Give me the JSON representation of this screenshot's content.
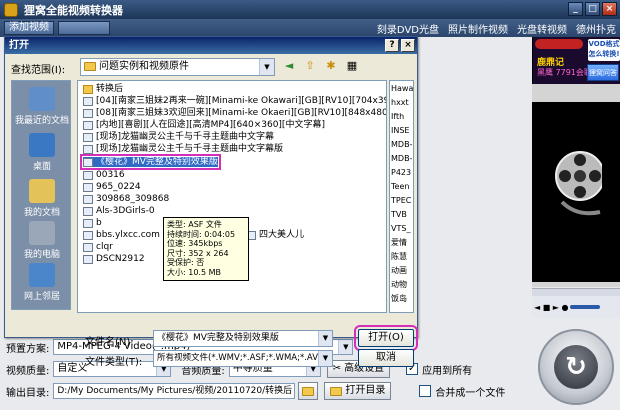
{
  "app": {
    "title": "狸窝全能视频转换器",
    "window_controls": [
      "_",
      "□",
      "×"
    ]
  },
  "toolbar": {
    "add_video": "添加视频",
    "dim_button": "",
    "right_items": [
      "刻录DVD光盘",
      "照片制作视频",
      "光盘转视频",
      "德州扑克"
    ]
  },
  "ad": {
    "vod_text": "VOD格式 怎么转换!",
    "headline": "鹿鼎记",
    "sub": "黑鹰 7791会联盟",
    "button": "狸窝问答"
  },
  "preview": {
    "controls": "◄ ■ ► ●"
  },
  "dialog": {
    "title": "打开",
    "close": "×",
    "help": "?",
    "lookin_label": "查找范围(I):",
    "lookin_value": "问题实例和视频原件",
    "places": [
      {
        "label": "我最近的文档",
        "color": "#5f8ec9"
      },
      {
        "label": "桌面",
        "color": "#3a78c4"
      },
      {
        "label": "我的文档",
        "color": "#e3c25a"
      },
      {
        "label": "我的电脑",
        "color": "#9aa7b8"
      },
      {
        "label": "网上邻居",
        "color": "#4a86c9"
      }
    ],
    "files": [
      {
        "name": "转换后",
        "folder": true
      },
      {
        "name": "[04][南家三姐妹2再来一碗][Minami-ke Okawari][GB][RV10][704x396]",
        "folder": false
      },
      {
        "name": "[08][南家三姐妹3欢迎回来][Minami-ke Okaeri][GB][RV10][848x480]",
        "folder": false
      },
      {
        "name": "[内地][喜剧][人在囧途][高清MP4][640×360][中文字幕]",
        "folder": false
      },
      {
        "name": "[现场]龙猫幽灵公主千与千寻主题曲中文字幕",
        "folder": false
      },
      {
        "name": "[现场]龙猫幽灵公主千与千寻主题曲中文字幕版",
        "folder": false
      },
      {
        "name": "《樱花》MV完整及特别效果版",
        "folder": false,
        "selected": true
      },
      {
        "name": "00316",
        "folder": false
      },
      {
        "name": "965_0224",
        "folder": false
      },
      {
        "name": "309868_309868",
        "folder": false
      },
      {
        "name": "Als-3DGirls-0",
        "folder": false
      },
      {
        "name": "b",
        "folder": false
      },
      {
        "name": "bbs.ylxcc.com",
        "folder": false
      },
      {
        "name": "clqr",
        "folder": false
      },
      {
        "name": "DSCN2912",
        "folder": false
      }
    ],
    "file_extra": "四大美人儿",
    "col2_files": [
      "Hawa",
      "hxxt",
      "Ifth",
      "INSE",
      "MDB-",
      "MDB-",
      "P423",
      "Teen",
      "TPEC",
      "TVB",
      "VTS_",
      "爱情",
      "陈慧",
      "动画",
      "动物",
      "饭岛"
    ],
    "tooltip": [
      "类型: ASF 文件",
      "持续时间: 0:04:05",
      "位速: 345kbps",
      "尺寸: 352 x 264",
      "受保护: 否",
      "大小: 10.5 MB"
    ],
    "filename_label": "文件名(N):",
    "filename_value": "《樱花》MV完整及特别效果版",
    "filetype_label": "文件类型(T):",
    "filetype_value": "所有视频文件(*.WMV;*.ASF;*.WMA;*.AVI;",
    "open_button": "打开(O)",
    "cancel_button": "取消"
  },
  "settings": {
    "preset_label": "预置方案:",
    "preset_value": "MP4-MPEG-4 Video(*.mp4)",
    "video_quality_label": "视频质量:",
    "video_quality_value": "自定义",
    "audio_quality_label": "音频质量:",
    "audio_quality_value": "中等质量",
    "advanced_button": "高级设置",
    "apply_all_label": "应用到所有",
    "apply_all_checked": true,
    "output_label": "输出目录:",
    "output_value": "D:/My Documents/My Pictures/视频/20110720/转换后",
    "open_dir_button": "打开目录",
    "merge_label": "合并成一个文件",
    "merge_checked": false
  }
}
